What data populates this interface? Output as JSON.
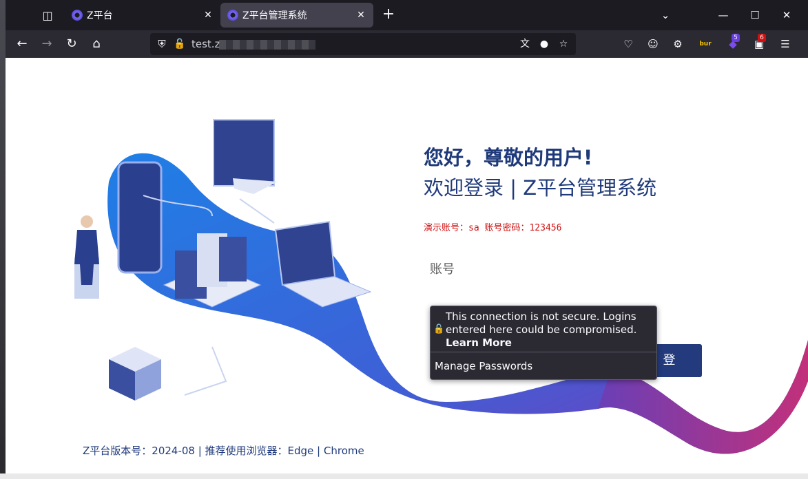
{
  "tabs": [
    {
      "title": "Z平台",
      "active": false
    },
    {
      "title": "Z平台管理系统",
      "active": true
    }
  ],
  "url": {
    "text": "test.z"
  },
  "extensions": {
    "burp_label": "bur",
    "badge_a": "5",
    "badge_b": "6"
  },
  "page": {
    "greeting": "您好，尊敬的用户!",
    "welcome": "欢迎登录 | Z平台管理系统",
    "demo_account": "演示账号：sa 账号密码：123456",
    "account_placeholder": "账号",
    "login_button": "登",
    "footer": "Z平台版本号：2024-08 | 推荐使用浏览器：Edge | Chrome"
  },
  "popup": {
    "warning": "This connection is not secure. Logins entered here could be compromised.",
    "learn_more": "Learn More",
    "manage": "Manage Passwords"
  },
  "colors": {
    "brand": "#1f3a7a",
    "button": "#233a7c",
    "demo": "#d01010"
  }
}
